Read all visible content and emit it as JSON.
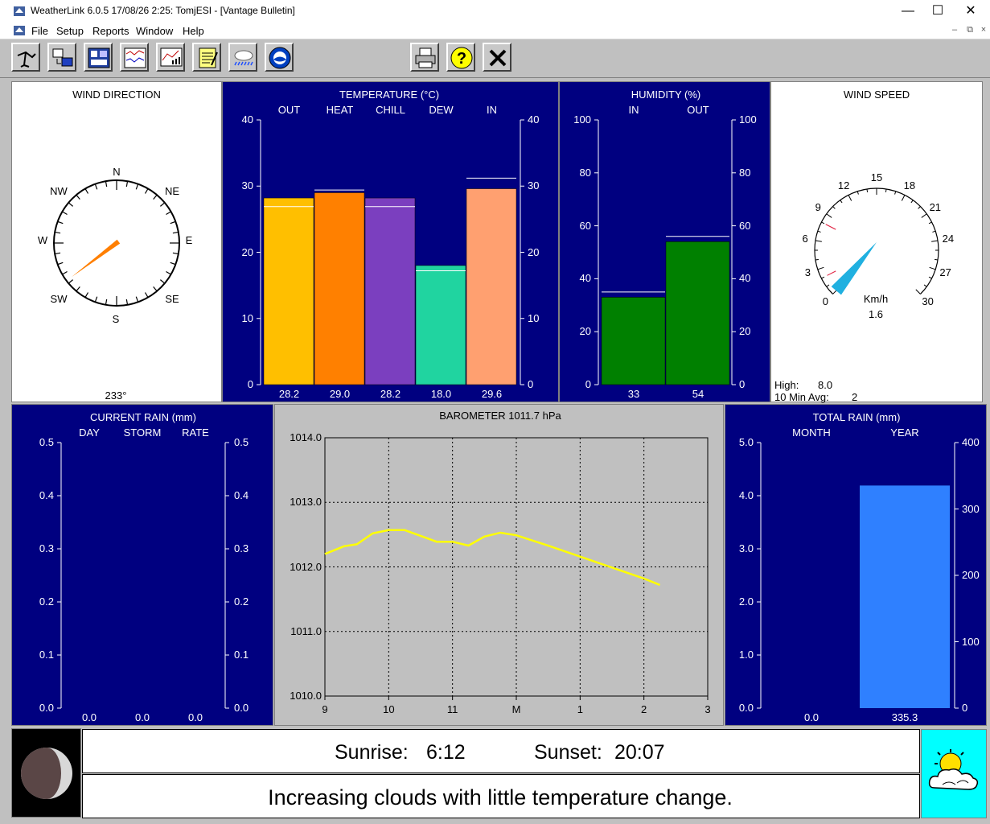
{
  "window": {
    "title": "WeatherLink 6.0.5  17/08/26   2:25: TomjESI - [Vantage Bulletin]",
    "minimize": "—",
    "maximize": "☐",
    "close": "✕"
  },
  "menu": {
    "items": [
      "File",
      "Setup",
      "Reports",
      "Window",
      "Help"
    ],
    "mdi": [
      "–",
      "⧉",
      "×"
    ]
  },
  "toolbar": {
    "icons": [
      "station-map-icon",
      "download-icon",
      "bulletin-icon",
      "strip-chart-icon",
      "graph-icon",
      "notepad-icon",
      "rain-cloud-icon",
      "noaa-icon",
      "print-icon",
      "help-icon",
      "close-icon"
    ]
  },
  "wind_direction": {
    "title": "WIND DIRECTION",
    "value": "233°",
    "degrees": 233,
    "labels": {
      "n": "N",
      "ne": "NE",
      "e": "E",
      "se": "SE",
      "s": "S",
      "sw": "SW",
      "w": "W",
      "nw": "NW"
    }
  },
  "temperature": {
    "title": "TEMPERATURE  (°C)",
    "ticks": [
      "0",
      "10",
      "20",
      "30",
      "40"
    ],
    "ylim": [
      0,
      40
    ],
    "bars": [
      {
        "label": "OUT",
        "value": "28.2",
        "num": 28.2,
        "marker": 26.9,
        "color": "#ffbf00"
      },
      {
        "label": "HEAT",
        "value": "29.0",
        "num": 29.0,
        "marker": 29.4,
        "color": "#ff8000"
      },
      {
        "label": "CHILL",
        "value": "28.2",
        "num": 28.2,
        "marker": 26.9,
        "color": "#7b3fbf"
      },
      {
        "label": "DEW",
        "value": "18.0",
        "num": 18.0,
        "marker": 17.2,
        "color": "#20d4a0"
      },
      {
        "label": "IN",
        "value": "29.6",
        "num": 29.6,
        "marker": 31.2,
        "color": "#ffa070"
      }
    ]
  },
  "humidity": {
    "title": "HUMIDITY  (%)",
    "ticks": [
      "0",
      "20",
      "40",
      "60",
      "80",
      "100"
    ],
    "ylim": [
      0,
      100
    ],
    "bars": [
      {
        "label": "IN",
        "value": "33",
        "num": 33,
        "marker": 35,
        "color": "#008000"
      },
      {
        "label": "OUT",
        "value": "54",
        "num": 54,
        "marker": 56,
        "color": "#008000"
      }
    ]
  },
  "wind_speed": {
    "title": "WIND SPEED",
    "unit": "Km/h",
    "value": "1.6",
    "num": 1.6,
    "scale": [
      "0",
      "3",
      "6",
      "9",
      "12",
      "15",
      "18",
      "21",
      "24",
      "27",
      "30"
    ],
    "high_label": "High:",
    "high": "8.0",
    "avg_label": "10 Min Avg:",
    "avg": "2"
  },
  "current_rain": {
    "title": "CURRENT RAIN  (mm)",
    "columns": [
      "DAY",
      "STORM",
      "RATE"
    ],
    "values": [
      "0.0",
      "0.0",
      "0.0"
    ],
    "ticks": [
      "0.0",
      "0.1",
      "0.2",
      "0.3",
      "0.4",
      "0.5"
    ]
  },
  "barometer": {
    "title": "BAROMETER 1011.7 hPa",
    "yticks": [
      "1010.0",
      "1011.0",
      "1012.0",
      "1013.0",
      "1014.0"
    ],
    "xticks": [
      "9",
      "10",
      "11",
      "M",
      "1",
      "2",
      "3"
    ]
  },
  "total_rain": {
    "title": "TOTAL RAIN  (mm)",
    "columns": [
      "MONTH",
      "YEAR"
    ],
    "values": [
      "0.0",
      "335.3"
    ],
    "left_ticks": [
      "0.0",
      "1.0",
      "2.0",
      "3.0",
      "4.0",
      "5.0"
    ],
    "right_ticks": [
      "0",
      "100",
      "200",
      "300",
      "400"
    ],
    "year_num": 335.3,
    "bar_color": "#2f80ff"
  },
  "chart_data": {
    "type": "line",
    "title": "BAROMETER 1011.7 hPa",
    "x": [
      9.0,
      9.3,
      9.5,
      9.75,
      10.0,
      10.25,
      10.5,
      10.75,
      11.0,
      11.25,
      11.5,
      11.75,
      12.0,
      12.5,
      13.0,
      13.5,
      14.0,
      14.25
    ],
    "y": [
      1012.2,
      1012.32,
      1012.35,
      1012.52,
      1012.57,
      1012.57,
      1012.48,
      1012.39,
      1012.39,
      1012.33,
      1012.47,
      1012.53,
      1012.49,
      1012.33,
      1012.16,
      1011.99,
      1011.82,
      1011.72
    ],
    "xlim": [
      9,
      15
    ],
    "ylim": [
      1010.0,
      1014.0
    ],
    "grid": true,
    "line_color": "#ffff00"
  },
  "almanac": {
    "sunrise_label": "Sunrise:",
    "sunrise": "6:12",
    "sunset_label": "Sunset:",
    "sunset": "20:07",
    "forecast": "Increasing clouds with little temperature change.",
    "moon_icon": "moon-phase-icon",
    "forecast_icon": "partly-cloudy-icon"
  }
}
